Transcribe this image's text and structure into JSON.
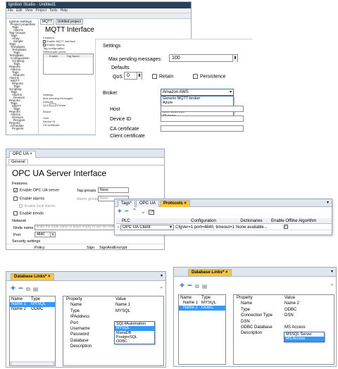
{
  "colors": {
    "title_dark": "#2c3f58",
    "selection": "#3399ff",
    "tab_active": "#f7c63d",
    "accent_blue": "#1c6fd1"
  },
  "mqtt": {
    "window_title": "Ignition Studio - Untitled1",
    "menus": [
      "File",
      "Edit",
      "View",
      "Project",
      "Tools",
      "Help"
    ],
    "tabs": [
      "MQTT",
      "Untitled project"
    ],
    "heading": "MQTT Interface",
    "settings_label": "Settings",
    "max_pending_label": "Max pending messages:",
    "max_pending_value": "100",
    "defaults_label": "Defaults",
    "qos_label": "QoS",
    "qos_value": "0",
    "retain_label": "Retain",
    "persistence_label": "Persistence",
    "broker_label": "Broker",
    "broker_value": "Amazon AWS",
    "broker_options": [
      "Generic MQTT broker",
      "Azure",
      "Amazon AWS",
      "IBM BlueMix",
      "Murano"
    ],
    "broker_selected_index": 2,
    "host_label": "Host",
    "device_id_label": "Device ID",
    "ca_cert_label": "CA certificate",
    "client_cert_label": "Client certificate",
    "mini_features": "Features",
    "mini_enable": "Enable MQTT interface",
    "mini_enable_alarms": "Enable alarms",
    "mini_tag_config": "Tag configuration",
    "mini_default_path": "Default path prefix",
    "mini_col_enable": "Enable",
    "mini_col_tag": "Tag Name",
    "mini_settings": "Settings",
    "mini_max_pending": "Max pending messages",
    "mini_defaults": "Defaults",
    "mini_qos": "QoS",
    "mini_persist": "Persist",
    "mini_broker": "Broker",
    "mini_host": "Host",
    "mini_device": "Device ID",
    "mini_ca": "CA certificate",
    "tree": [
      "Ignition Settings",
      "Project properties",
      "Tags",
      "Alarms",
      "Tag Groups",
      "Tags",
      "Array",
      "Simple",
      "Tags",
      "Templates",
      "Templates",
      "Tags",
      "Templates",
      "Configuration",
      "Scripting",
      "Tags",
      "Reports",
      "Alarms",
      "Tags",
      "Reports",
      "Alarms",
      "MQTT",
      "Reports",
      "Tags",
      "Scripting",
      "Tags",
      "Alarms",
      "Devices",
      "Reports",
      "Tags",
      "MQTT",
      "Tags",
      "Reports",
      "Alarms",
      "Devices",
      "Recipes",
      "Reports",
      "Schedule",
      "Projects"
    ]
  },
  "opcua": {
    "tab_label": "OPC UA",
    "sub_tab": "General",
    "heading": "OPC UA Server Interface",
    "features_label": "Features",
    "enable_server_label": "Enable OPC UA server",
    "tag_groups_label": "Tag groups",
    "tag_groups_value": "None",
    "enable_alarms_label": "Enable alarms",
    "alarm_groups_label": "Alarm groups",
    "alarm_groups_value": "None",
    "enable_local_alarms_label": "Enable local alarms",
    "enable_trends_label": "Enable trends",
    "network_label": "Network",
    "node_name_label": "Node name",
    "node_name_placeholder": "Enter the node name or leave empty to use the host",
    "port_label": "Port",
    "port_value": "4840",
    "security_label": "Security settings",
    "policy_col": "Policy",
    "sign_col": "Sign",
    "sign_encrypt_col": "SignAndEncrypt"
  },
  "protocols": {
    "tabs": [
      "Tags*",
      "OPC UA",
      "Protocols"
    ],
    "active_tab": "Protocols",
    "columns": [
      "PLC",
      "Configuration",
      "Dictionaries",
      "Enable Offline Algorithm"
    ],
    "row": {
      "plc": "OPC UA Client",
      "configuration": "CfgVer=1 port=4840, timeout=10",
      "dictionaries": "None available..."
    }
  },
  "db1": {
    "title": "Database Links*",
    "list_cols": [
      "Name",
      "Type"
    ],
    "list_rows": [
      {
        "name": "Name 1",
        "type": "MYSQL"
      },
      {
        "name": "Name 2",
        "type": "ODBC"
      }
    ],
    "prop_cols": [
      "Property",
      "Value"
    ],
    "props": [
      {
        "name": "Name",
        "value": "Name 1"
      },
      {
        "name": "Type",
        "value": "MYSQL"
      },
      {
        "name": "IPAddress",
        "value": ""
      },
      {
        "name": "Port",
        "value": ""
      },
      {
        "name": "Username",
        "value": ""
      },
      {
        "name": "Password",
        "value": ""
      },
      {
        "name": "Database",
        "value": ""
      },
      {
        "name": "Description",
        "value": ""
      }
    ],
    "dropdown": [
      "SQL4Automation",
      "MYSQL",
      "MariaDB",
      "PostgreSQL",
      "ODBC"
    ],
    "dropdown_selected_index": 1
  },
  "db2": {
    "title": "Database Links*",
    "list_cols": [
      "Name",
      "Type"
    ],
    "list_rows": [
      {
        "name": "Name 1",
        "type": "MYSQL"
      },
      {
        "name": "Name 2",
        "type": "ODBC"
      }
    ],
    "prop_cols": [
      "Property",
      "Value"
    ],
    "props": [
      {
        "name": "Name",
        "value": "Name 2"
      },
      {
        "name": "Type",
        "value": "ODBC"
      },
      {
        "name": "Connection Type",
        "value": "DSN"
      },
      {
        "name": "DSN",
        "value": ""
      },
      {
        "name": "ODBC Database",
        "value": "MS Access"
      },
      {
        "name": "Description",
        "value": ""
      }
    ],
    "dropdown": [
      "MSSQL Server",
      "MS Access"
    ],
    "dropdown_selected_index": 1
  }
}
